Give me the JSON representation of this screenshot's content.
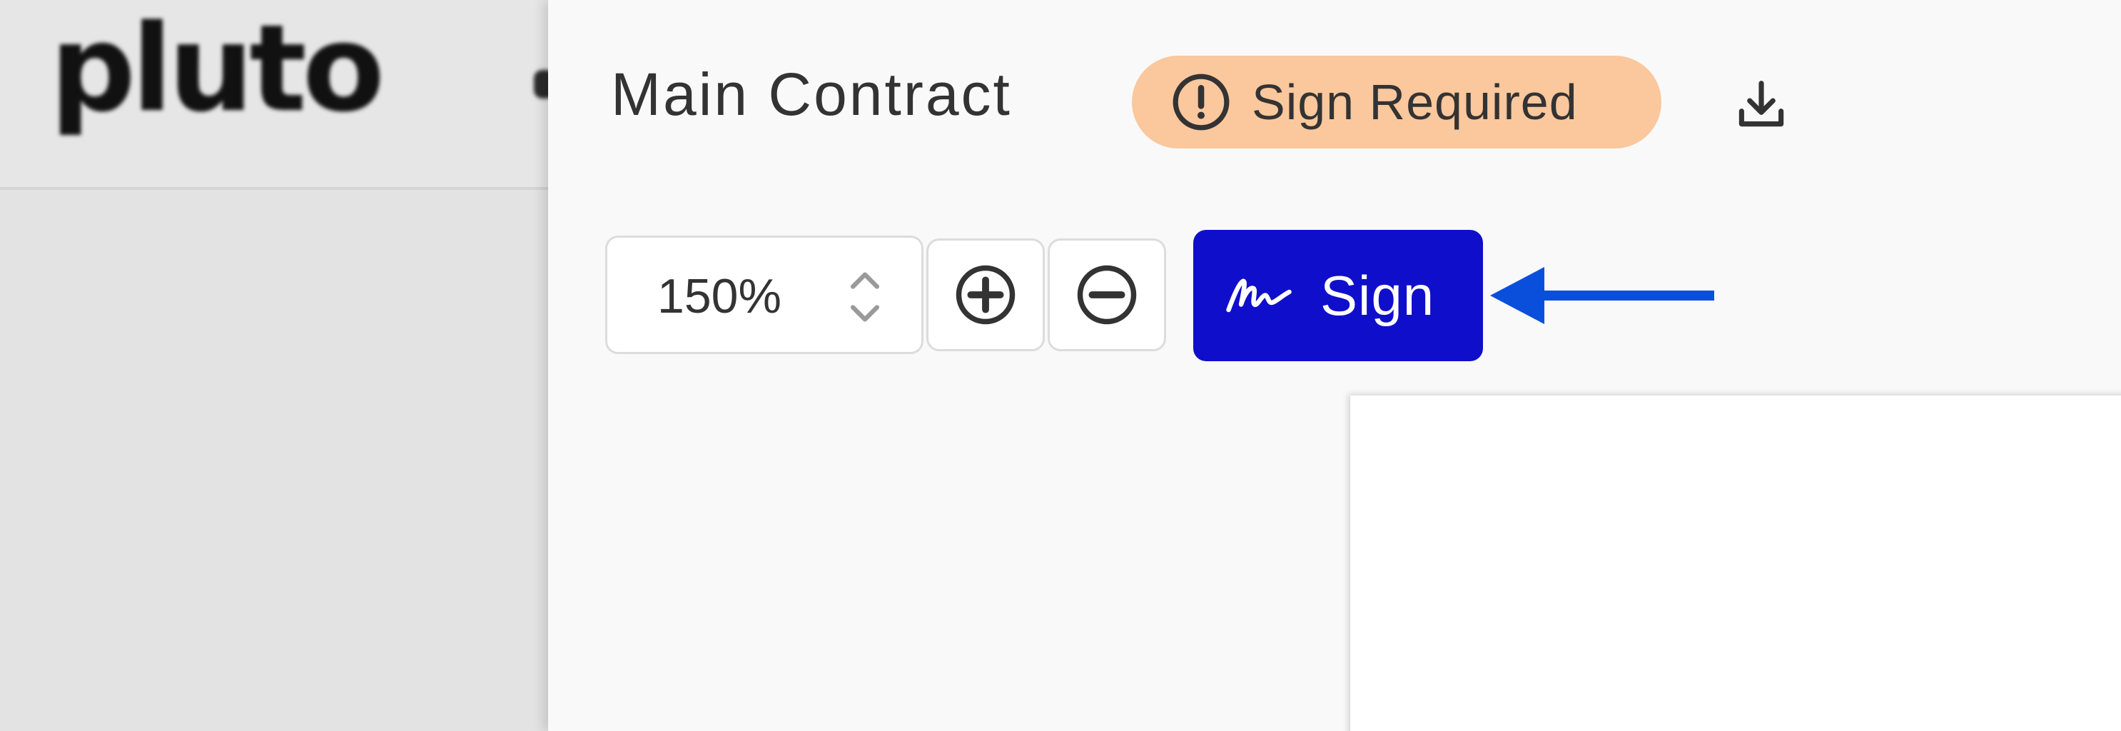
{
  "app": {
    "logo_text": "pluto"
  },
  "document": {
    "title": "Main Contract",
    "status_badge": "Sign Required",
    "status_color": "#fbc79c"
  },
  "toolbar": {
    "zoom_value": "150%",
    "sign_label": "Sign",
    "sign_color": "#0f0fcb",
    "icons": {
      "download": "download-icon",
      "zoom_in": "plus-circle-icon",
      "zoom_out": "minus-circle-icon",
      "sign": "signature-icon",
      "status": "exclamation-circle-icon",
      "stepper": "chevron-up-down-icon"
    }
  },
  "annotation": {
    "arrow_color": "#0a4fdc"
  }
}
